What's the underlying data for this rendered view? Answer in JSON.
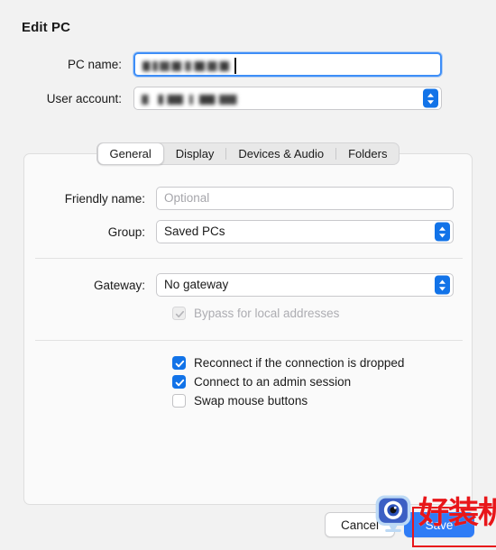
{
  "dialog": {
    "title": "Edit PC"
  },
  "top_form": {
    "pc_name": {
      "label": "PC name:",
      "value": "",
      "focused": true
    },
    "user_account": {
      "label": "User account:",
      "value": ""
    }
  },
  "tabs": [
    {
      "label": "General",
      "active": true
    },
    {
      "label": "Display",
      "active": false
    },
    {
      "label": "Devices & Audio",
      "active": false
    },
    {
      "label": "Folders",
      "active": false
    }
  ],
  "general_panel": {
    "friendly_name": {
      "label": "Friendly name:",
      "value": "",
      "placeholder": "Optional"
    },
    "group": {
      "label": "Group:",
      "value": "Saved PCs"
    },
    "gateway": {
      "label": "Gateway:",
      "value": "No gateway"
    },
    "bypass_local": {
      "label": "Bypass for local addresses",
      "checked": true,
      "disabled": true
    },
    "checkboxes": [
      {
        "label": "Reconnect if the connection is dropped",
        "checked": true
      },
      {
        "label": "Connect to an admin session",
        "checked": true
      },
      {
        "label": "Swap mouse buttons",
        "checked": false
      }
    ]
  },
  "footer": {
    "cancel_label": "Cancel",
    "save_label": "Save"
  },
  "watermark": {
    "text": "好装机"
  },
  "colors": {
    "accent_blue": "#1273e8",
    "primary_button": "#2f7cf6",
    "focus_ring": "#3e8ef7",
    "watermark_red": "#e8161a",
    "window_bg": "#f2f2f2",
    "panel_bg": "#fafafa"
  }
}
